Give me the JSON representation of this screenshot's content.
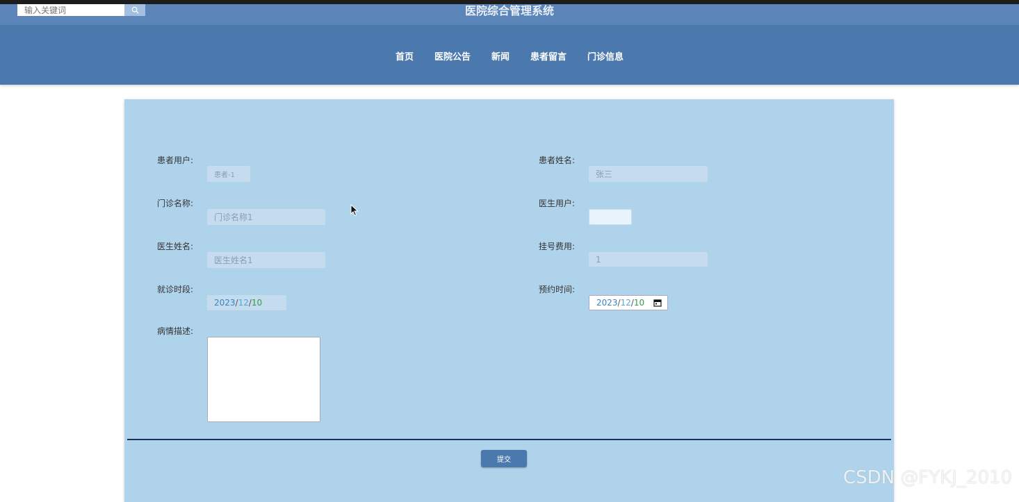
{
  "header": {
    "search_placeholder": "输入关键词",
    "site_title": "医院综合管理系统"
  },
  "nav": {
    "items": [
      "首页",
      "医院公告",
      "新闻",
      "患者留言",
      "门诊信息"
    ]
  },
  "form": {
    "patient_user_label": "患者用户:",
    "patient_user_value": "患者-1",
    "patient_name_label": "患者姓名:",
    "patient_name_value": "张三",
    "clinic_name_label": "门诊名称:",
    "clinic_name_value": "门诊名称1",
    "doctor_user_label": "医生用户:",
    "doctor_user_value": "",
    "doctor_name_label": "医生姓名:",
    "doctor_name_value": "医生姓名1",
    "fee_label": "挂号费用:",
    "fee_value": "1",
    "visit_period_label": "就诊时段:",
    "visit_period": {
      "year": "2023",
      "month": "12",
      "day": "10"
    },
    "appointment_time_label": "预约时间:",
    "appointment_time": {
      "year": "2023",
      "month": "12",
      "day": "10"
    },
    "condition_label": "病情描述:",
    "condition_value": "",
    "submit_label": "提交"
  },
  "watermark": "CSDN @FYKJ_2010",
  "icons": [
    "search-icon",
    "calendar-icon",
    "mouse-cursor-icon"
  ]
}
